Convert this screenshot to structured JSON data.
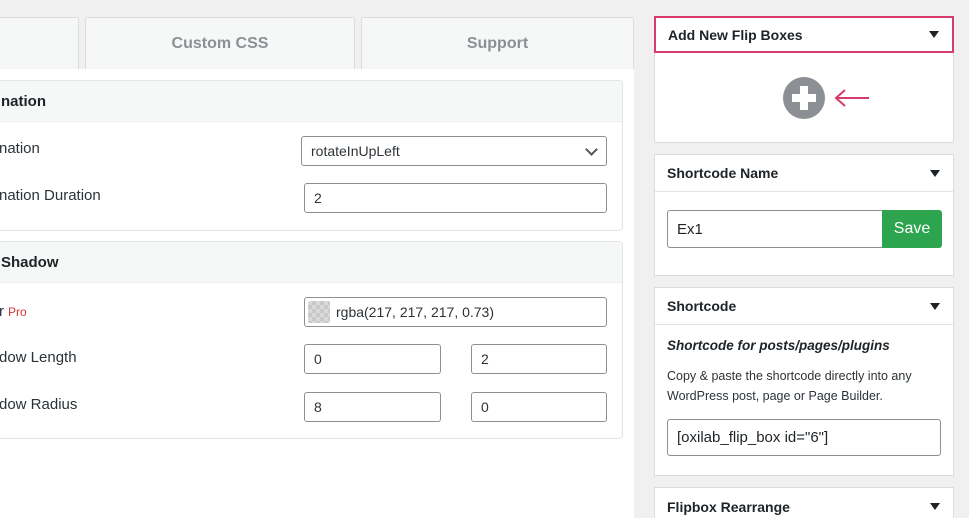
{
  "tabs": [
    {
      "label": ""
    },
    {
      "label": "Custom CSS"
    },
    {
      "label": "Support"
    }
  ],
  "animation_section": {
    "title": "nation",
    "animation_label": "nation",
    "animation_value": "rotateInUpLeft",
    "duration_label": "nation Duration",
    "duration_value": "2"
  },
  "shadow_section": {
    "title": "Shadow",
    "color_label": "r",
    "pro_badge": "Pro",
    "color_value": "rgba(217, 217, 217, 0.73)",
    "length_label": "dow Length",
    "length_values": [
      "0",
      "2"
    ],
    "radius_label": "dow Radius",
    "radius_values": [
      "8",
      "0"
    ]
  },
  "sidebar": {
    "add_new": {
      "title": "Add New Flip Boxes",
      "icon": "plus-circle-icon"
    },
    "shortcode_name": {
      "title": "Shortcode Name",
      "value": "Ex1",
      "save_label": "Save"
    },
    "shortcode": {
      "title": "Shortcode",
      "subtitle": "Shortcode for posts/pages/plugins",
      "description": "Copy & paste the shortcode directly into any WordPress post, page or Page Builder.",
      "code": "[oxilab_flip_box id=\"6\"]"
    },
    "rearrange": {
      "title": "Flipbox Rearrange"
    }
  },
  "colors": {
    "save": "#2da44e",
    "highlight": "#d63b6a",
    "pro": "#d63638"
  }
}
